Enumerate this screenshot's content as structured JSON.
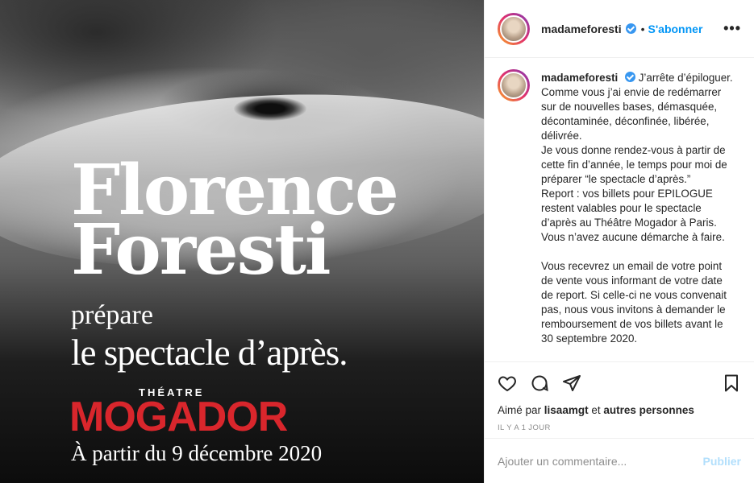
{
  "poster": {
    "title_line1": "Florence",
    "title_line2": "Foresti",
    "subtitle1": "prépare",
    "subtitle2": "le spectacle d’après.",
    "venue_prefix": "THÉATRE",
    "venue_name": "MOGADOR",
    "date": "À partir du 9 décembre 2020"
  },
  "header": {
    "username": "madameforesti",
    "separator": "•",
    "follow_label": "S'abonner",
    "more_label": "•••"
  },
  "caption": {
    "username": "madameforesti",
    "lines": [
      "J’arrête d’épiloguer.",
      "Comme vous j’ai envie de redémarrer sur de nouvelles bases, démasquée, décontaminée, déconfinée, libérée, délivrée.",
      "Je vous donne rendez-vous à partir de cette fin d’année, le temps pour moi de préparer “le spectacle d’après.”",
      "Report : vos billets pour EPILOGUE restent valables pour le spectacle d’après au Théâtre Mogador à Paris. Vous n’avez aucune démarche à faire.",
      "",
      "Vous recevrez un email de votre point de vente vous informant de votre date de report. Si celle-ci ne vous convenait pas, nous vous invitons à demander le remboursement de vos billets avant le 30 septembre 2020."
    ]
  },
  "likes": {
    "prefix": "Aimé par",
    "user": "lisaamgt",
    "connector": "et",
    "others": "autres personnes"
  },
  "timestamp": "IL Y A 1 JOUR",
  "comment_box": {
    "placeholder": "Ajouter un commentaire...",
    "publish_label": "Publier"
  },
  "colors": {
    "follow": "#0095f6",
    "verified": "#3897f0",
    "mogador": "#d9262c",
    "publish_disabled": "#b2dffc"
  }
}
